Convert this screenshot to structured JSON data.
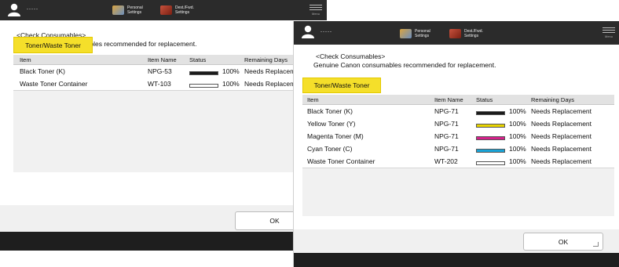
{
  "toolbar": {
    "user_name": "-----",
    "personal_settings": [
      "Personal",
      "Settings"
    ],
    "dest_pwd_settings": [
      "Dest./Fwd.",
      "Settings"
    ],
    "menu_label": "Menu"
  },
  "dialog": {
    "title": "<Check Consumables>",
    "subtitle": "Genuine Canon consumables recommended for replacement.",
    "tab_label": "Toner/Waste Toner",
    "ok_label": "OK",
    "columns": [
      "Item",
      "Item Name",
      "Status",
      "Remaining Days"
    ]
  },
  "back_list": [
    {
      "item": "Black Toner (K)",
      "name": "NPG-53",
      "percent": "100%",
      "level": 1.0,
      "meter_color": "#1a1a1a",
      "days": "Needs Replacement",
      "days_visible": "Needs Replaceme"
    },
    {
      "item": "Waste Toner Container",
      "name": "WT-103",
      "percent": "100%",
      "level": 0.0,
      "meter_color": "#ffffff",
      "days": "Needs Replacement",
      "days_visible": "Needs Replaceme"
    }
  ],
  "front_list": [
    {
      "item": "Black Toner (K)",
      "name": "NPG-71",
      "percent": "100%",
      "level": 1.0,
      "meter_color": "#1a1a1a",
      "days": "Needs Replacement"
    },
    {
      "item": "Yellow Toner (Y)",
      "name": "NPG-71",
      "percent": "100%",
      "level": 1.0,
      "meter_color": "#e8d400",
      "days": "Needs Replacement"
    },
    {
      "item": "Magenta Toner (M)",
      "name": "NPG-71",
      "percent": "100%",
      "level": 1.0,
      "meter_color": "#d4218a",
      "days": "Needs Replacement"
    },
    {
      "item": "Cyan Toner (C)",
      "name": "NPG-71",
      "percent": "100%",
      "level": 1.0,
      "meter_color": "#1aa3d6",
      "days": "Needs Replacement"
    },
    {
      "item": "Waste Toner Container",
      "name": "WT-202",
      "percent": "100%",
      "level": 0.0,
      "meter_color": "#ffffff",
      "days": "Needs Replacement"
    }
  ]
}
